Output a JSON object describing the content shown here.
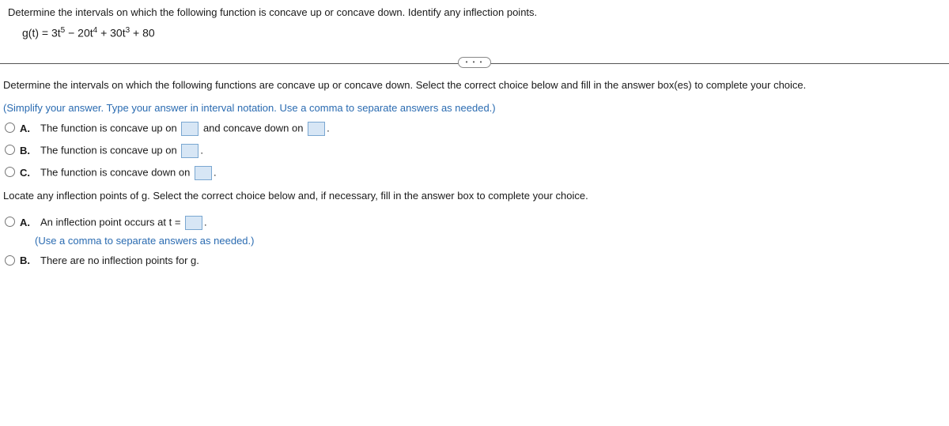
{
  "top": {
    "prompt": "Determine the intervals on which the following function is concave up or concave down. Identify any inflection points.",
    "formula_prefix": "g(t) = 3t",
    "exp1": "5",
    "mid1": " − 20t",
    "exp2": "4",
    "mid2": " + 30t",
    "exp3": "3",
    "tail": " + 80"
  },
  "divider_label": "• • •",
  "q1": {
    "instruction": "Determine the intervals on which the following functions are concave up or concave down. Select the correct choice below and fill in the answer box(es) to complete your choice.",
    "hint": "(Simplify your answer. Type your answer in interval notation. Use a comma to separate answers as needed.)",
    "choices": {
      "A": {
        "letter": "A.",
        "pre": "The function is concave up on ",
        "mid": " and concave down on ",
        "post": "."
      },
      "B": {
        "letter": "B.",
        "pre": "The function is concave up on ",
        "post": "."
      },
      "C": {
        "letter": "C.",
        "pre": "The function is concave down on ",
        "post": "."
      }
    }
  },
  "q2": {
    "prompt": "Locate any inflection points of g. Select the correct choice below and, if necessary, fill in the answer box to complete your choice.",
    "choices": {
      "A": {
        "letter": "A.",
        "pre": "An inflection point occurs at t = ",
        "post": ".",
        "hint": "(Use a comma to separate answers as needed.)"
      },
      "B": {
        "letter": "B.",
        "text": "There are no inflection points for g."
      }
    }
  }
}
